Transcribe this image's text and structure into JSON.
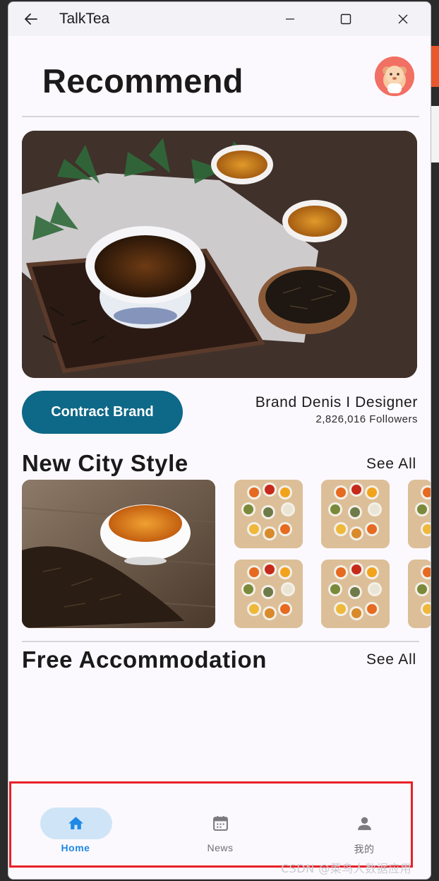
{
  "window": {
    "title": "TalkTea"
  },
  "header": {
    "title": "Recommend"
  },
  "brand": {
    "button_label": "Contract Brand",
    "name": "Brand Denis I Designer",
    "followers": "2,826,016 Followers"
  },
  "sections": {
    "new_city": {
      "title": "New City Style",
      "see_all": "See All"
    },
    "free_accommodation": {
      "title": "Free Accommodation",
      "see_all": "See All"
    }
  },
  "nav": {
    "items": [
      {
        "label": "Home",
        "icon": "home-icon",
        "active": true
      },
      {
        "label": "News",
        "icon": "calendar-icon",
        "active": false
      },
      {
        "label": "我的",
        "icon": "person-icon",
        "active": false
      }
    ]
  },
  "watermark": "CSDN @菜鸟人数据应用",
  "colors": {
    "accent": "#0e6887",
    "nav_active": "#1e88e5",
    "nav_pill": "#cfe5f7",
    "highlight": "#e82127"
  }
}
